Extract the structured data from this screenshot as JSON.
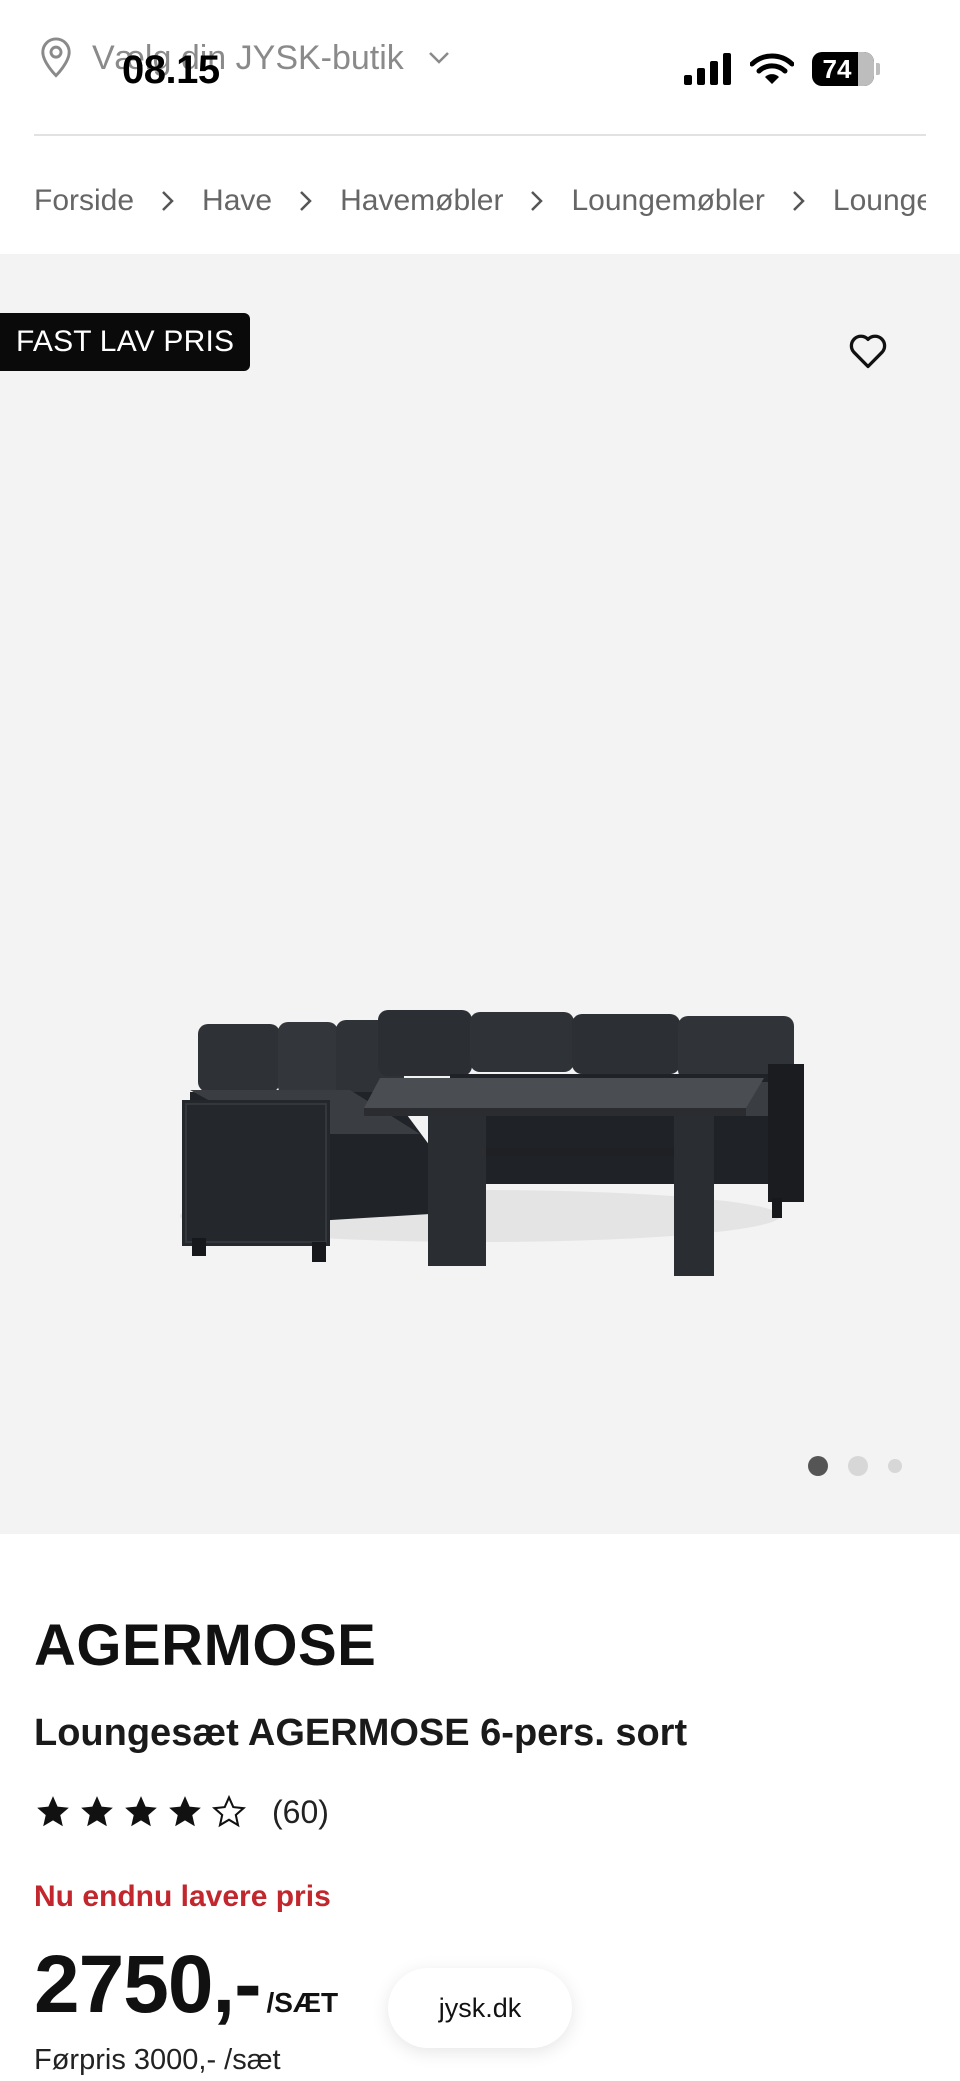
{
  "status_bar": {
    "time": "08.15",
    "battery": "74"
  },
  "store_selector": {
    "label": "Vælg din JYSK-butik"
  },
  "breadcrumb": {
    "items": [
      "Forside",
      "Have",
      "Havemøbler",
      "Loungemøbler",
      "Loungesæt"
    ]
  },
  "gallery": {
    "badge": "FAST LAV PRIS",
    "image_count": 3,
    "active_index": 0
  },
  "product": {
    "brand": "AGERMOSE",
    "name": "Loungesæt AGERMOSE 6-pers. sort",
    "rating": 4,
    "rating_max": 5,
    "review_count": "(60)",
    "promo_text": "Nu endnu lavere pris",
    "price": "2750,-",
    "price_unit": "/SÆT",
    "before_price": "Førpris 3000,- /sæt"
  },
  "browser": {
    "url": "jysk.dk"
  },
  "colors": {
    "promo": "#c1272d",
    "badge_bg": "#0a0a0a",
    "hero_bg": "#f3f3f3"
  }
}
